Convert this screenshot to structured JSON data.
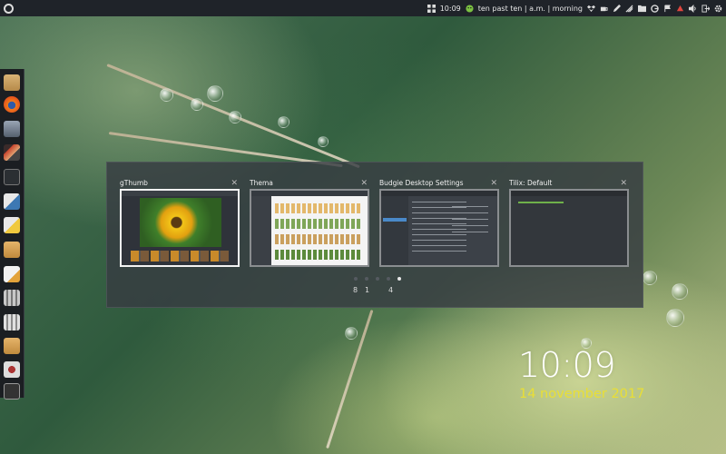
{
  "top_panel": {
    "time": "10:09",
    "fuzzy_clock": "ten past ten | a.m. | morning",
    "tray_icons": [
      "grid-icon",
      "face-icon",
      "dropbox-icon",
      "cup-icon",
      "pen-icon",
      "network-icon",
      "folder-icon",
      "google-icon",
      "flag-icon",
      "power-dot-icon",
      "volume-icon",
      "logout-icon",
      "settings-icon"
    ]
  },
  "dock": {
    "items": [
      "files-icon",
      "firefox-icon",
      "image-viewer-icon",
      "video-icon",
      "terminal-icon",
      "python-icon",
      "python-icon-2",
      "folder-icon",
      "text-editor-icon",
      "chart-icon",
      "spreadsheet-icon",
      "folder-icon-2",
      "gthumb-icon",
      "tilix-icon"
    ]
  },
  "switcher": {
    "windows": [
      {
        "title": "gThumb",
        "close": "✕",
        "active": true
      },
      {
        "title": "Thema",
        "close": "✕",
        "active": false
      },
      {
        "title": "Budgie Desktop Settings",
        "close": "✕",
        "active": false
      },
      {
        "title": "Tilix: Default",
        "close": "✕",
        "active": false
      }
    ],
    "workspace_labels": [
      "8",
      "1",
      "4"
    ],
    "active_dot": 3
  },
  "desktop_clock": {
    "time": "10:09",
    "date": "14 november 2017"
  },
  "colors": {
    "date": "#e9df35",
    "panel": "#1f2329",
    "switcher_bg": "#373c42"
  }
}
